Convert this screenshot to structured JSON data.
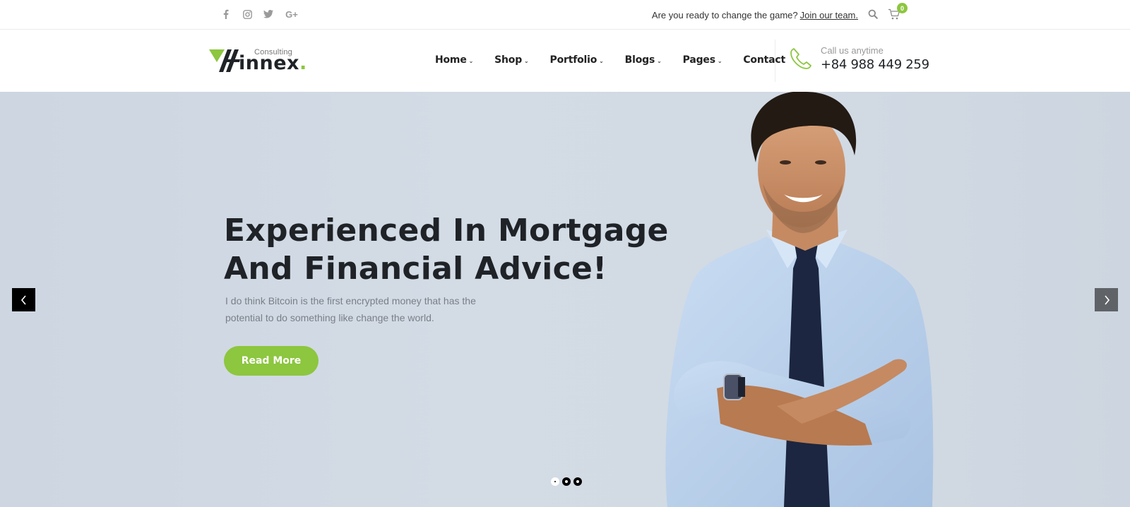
{
  "topbar": {
    "social": [
      {
        "name": "facebook-icon",
        "glyph": "f"
      },
      {
        "name": "instagram-icon",
        "glyph": ""
      },
      {
        "name": "twitter-icon",
        "glyph": ""
      },
      {
        "name": "google-plus-icon",
        "glyph": "G+"
      }
    ],
    "message": "Are you ready to change the game?",
    "join_link": "Join our team.",
    "cart_count": "0"
  },
  "header": {
    "logo": {
      "tagline": "Consulting",
      "word": "innex",
      "dot": "."
    },
    "nav": [
      {
        "label": "Home",
        "has_dropdown": true
      },
      {
        "label": "Shop",
        "has_dropdown": true
      },
      {
        "label": "Portfolio",
        "has_dropdown": true
      },
      {
        "label": "Blogs",
        "has_dropdown": true
      },
      {
        "label": "Pages",
        "has_dropdown": true
      },
      {
        "label": "Contact",
        "has_dropdown": false
      }
    ],
    "call": {
      "label": "Call us anytime",
      "number": "+84 988 449 259"
    }
  },
  "hero": {
    "title_line1": "Experienced In Mortgage",
    "title_line2": "And Financial Advice!",
    "description": "I do think Bitcoin is the first encrypted money that has the potential to do something like change the world.",
    "cta_label": "Read More",
    "slides": 3,
    "active_slide": 1
  },
  "colors": {
    "accent": "#8dc63f",
    "text_dark": "#1f2327",
    "hero_bg": "#d2dae4"
  }
}
